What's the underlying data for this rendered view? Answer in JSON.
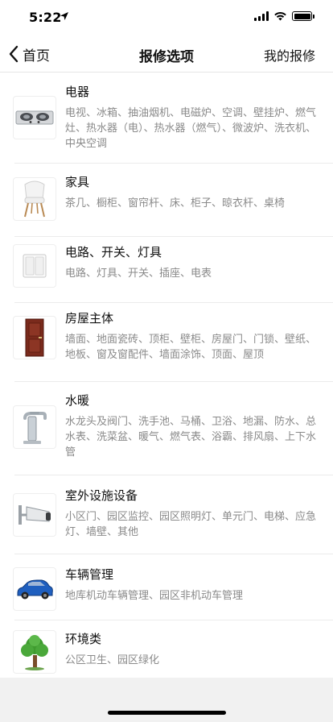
{
  "status_bar": {
    "time": "5:22"
  },
  "nav": {
    "back_label": "首页",
    "title": "报修选项",
    "right_label": "我的报修"
  },
  "categories": [
    {
      "title": "电器",
      "desc": "电视、冰箱、抽油烟机、电磁炉、空调、壁挂炉、燃气灶、热水器（电）、热水器（燃气）、微波炉、洗衣机、中央空调",
      "icon": "gas-stove-icon"
    },
    {
      "title": "家具",
      "desc": "茶几、橱柜、窗帘杆、床、柜子、晾衣杆、桌椅",
      "icon": "chair-icon"
    },
    {
      "title": "电路、开关、灯具",
      "desc": "电路、灯具、开关、插座、电表",
      "icon": "light-switch-icon"
    },
    {
      "title": "房屋主体",
      "desc": "墙面、地面瓷砖、顶柜、壁柜、房屋门、门锁、壁纸、地板、窗及窗配件、墙面涂饰、顶面、屋顶",
      "icon": "door-icon"
    },
    {
      "title": "水暖",
      "desc": "水龙头及阀门、洗手池、马桶、卫浴、地漏、防水、总水表、洗菜盆、暖气、燃气表、浴霸、排风扇、上下水管",
      "icon": "faucet-icon"
    },
    {
      "title": "室外设施设备",
      "desc": "小区门、园区监控、园区照明灯、单元门、电梯、应急灯、墙壁、其他",
      "icon": "security-camera-icon"
    },
    {
      "title": "车辆管理",
      "desc": "地库机动车辆管理、园区非机动车管理",
      "icon": "car-icon"
    },
    {
      "title": "环境类",
      "desc": "公区卫生、园区绿化",
      "icon": "tree-icon"
    }
  ]
}
